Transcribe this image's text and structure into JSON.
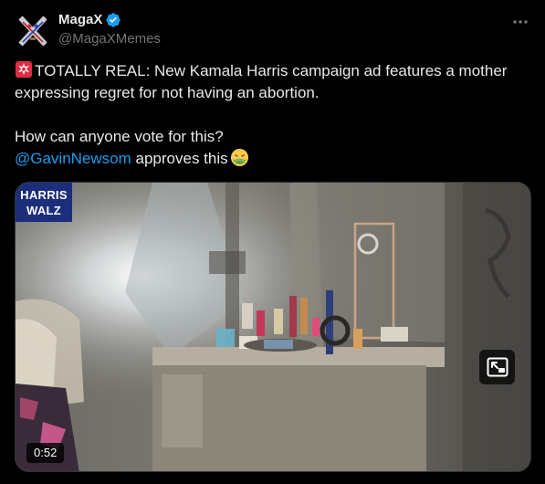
{
  "author": {
    "display_name": "MagaX",
    "handle": "@MagaXMemes",
    "verified": true,
    "avatar_icon": "crossed-swords-x-logo"
  },
  "more_icon": "more-horizontal-icon",
  "tweet": {
    "emoji_lead": "rotating-light-emoji",
    "line1": "TOTALLY REAL: New Kamala Harris campaign ad features a mother expressing regret for not having an abortion.",
    "line2": "How can anyone vote for this?",
    "mention": "@GavinNewsom",
    "line3_rest": " approves this",
    "emoji_trail": "nauseated-face-emoji"
  },
  "media": {
    "watermark_line1": "HARRIS",
    "watermark_line2": "WALZ",
    "duration": "0:52",
    "pip_icon": "picture-in-picture-icon"
  },
  "colors": {
    "background": "#000000",
    "text": "#e7e9ea",
    "secondary": "#71767b",
    "link": "#1d9bf0",
    "verified": "#1d9bf0",
    "watermark_bg": "#1c2e7a"
  }
}
